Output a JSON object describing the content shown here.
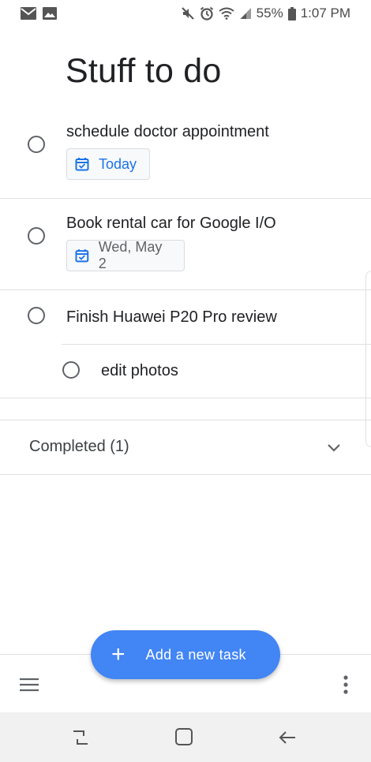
{
  "status_bar": {
    "left_icons": [
      "mail-icon",
      "image-icon"
    ],
    "right_icons": [
      "mute-icon",
      "alarm-icon",
      "wifi-icon",
      "signal-icon",
      "battery-icon"
    ],
    "battery": "55%",
    "time": "1:07 PM"
  },
  "page": {
    "title": "Stuff to do"
  },
  "tasks": [
    {
      "title": "schedule doctor appointment",
      "due": "Today",
      "due_style": "today"
    },
    {
      "title": "Book rental car for Google I/O",
      "due": "Wed, May 2",
      "due_style": "future"
    },
    {
      "title": "Finish Huawei P20 Pro review",
      "subtasks": [
        {
          "title": "edit photos"
        }
      ]
    }
  ],
  "completed": {
    "label": "Completed (1)",
    "icon": "chevron-down-icon"
  },
  "fab": {
    "icon": "plus-icon",
    "label": "Add a new task"
  },
  "bottom_bar": {
    "left_icon": "menu-icon",
    "right_icon": "more-vert-icon"
  },
  "nav_bar": {
    "icons": [
      "recent-apps-icon",
      "home-icon",
      "back-icon"
    ]
  },
  "colors": {
    "accent": "#1a73e8",
    "fab": "#4285f4",
    "text": "#202124"
  }
}
